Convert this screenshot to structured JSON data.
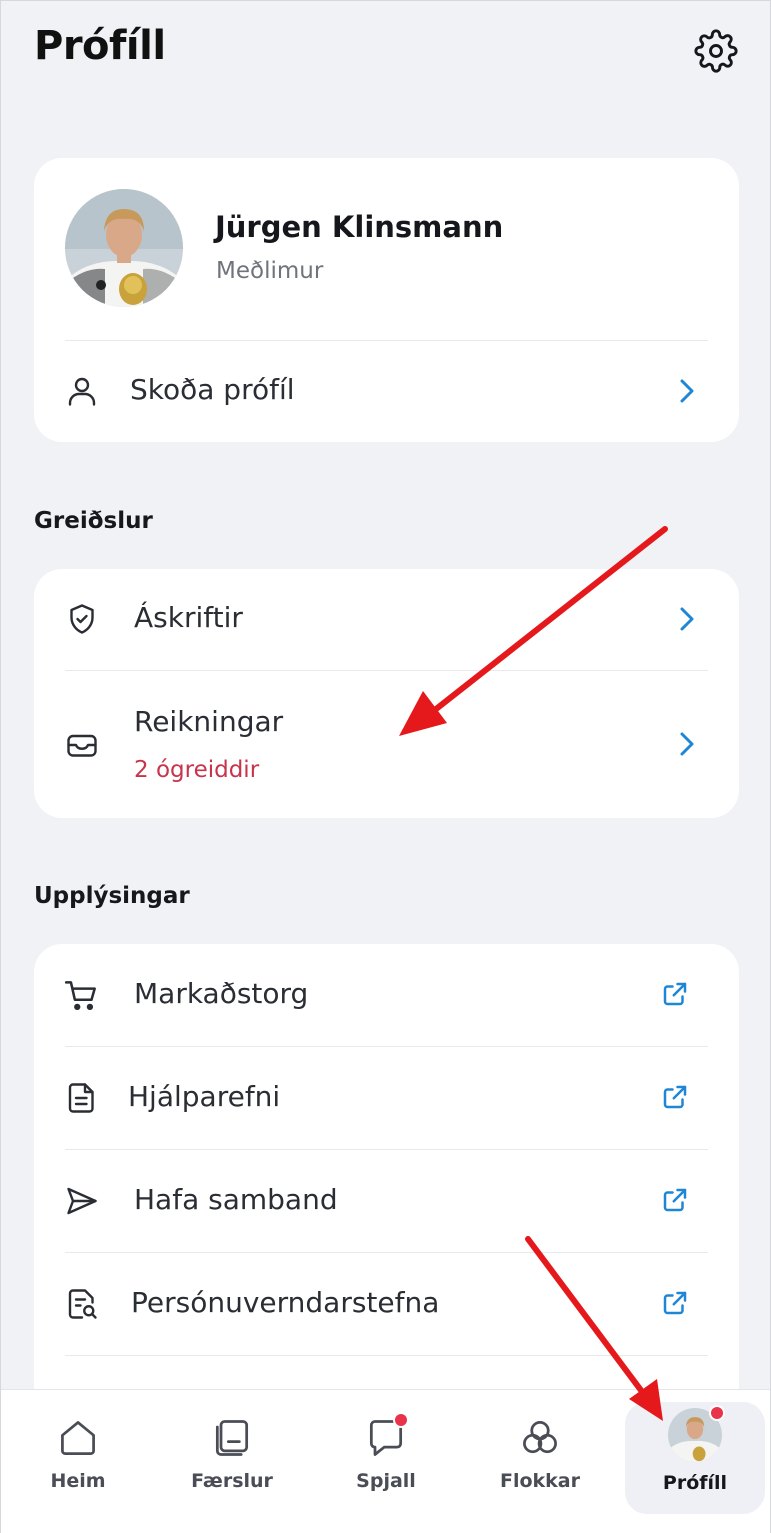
{
  "header": {
    "title": "Prófíll",
    "settings_icon": "gear-icon"
  },
  "profile": {
    "name": "Jürgen Klinsmann",
    "role": "Meðlimur",
    "view_profile_label": "Skoða prófíl"
  },
  "payments": {
    "section_title": "Greiðslur",
    "items": [
      {
        "label": "Áskriftir",
        "icon": "shield-check-icon"
      },
      {
        "label": "Reikningar",
        "sublabel": "2 ógreiddir",
        "icon": "inbox-icon"
      }
    ]
  },
  "info": {
    "section_title": "Upplýsingar",
    "items": [
      {
        "label": "Markaðstorg",
        "icon": "cart-icon"
      },
      {
        "label": "Hjálparefni",
        "icon": "document-icon"
      },
      {
        "label": "Hafa samband",
        "icon": "send-icon"
      },
      {
        "label": "Persónuverndarstefna",
        "icon": "document-search-icon"
      }
    ]
  },
  "tabbar": {
    "tabs": [
      {
        "label": "Heim",
        "icon": "home-icon"
      },
      {
        "label": "Færslur",
        "icon": "transactions-icon"
      },
      {
        "label": "Spjall",
        "icon": "chat-icon",
        "has_badge": true
      },
      {
        "label": "Flokkar",
        "icon": "categories-icon"
      },
      {
        "label": "Prófíll",
        "icon": "avatar",
        "has_badge": true,
        "active": true
      }
    ]
  },
  "colors": {
    "accent": "#1f86d6",
    "alert": "#c8344a",
    "badge": "#e9334a",
    "annotation_arrow": "#e5191c",
    "background": "#f1f2f6"
  }
}
